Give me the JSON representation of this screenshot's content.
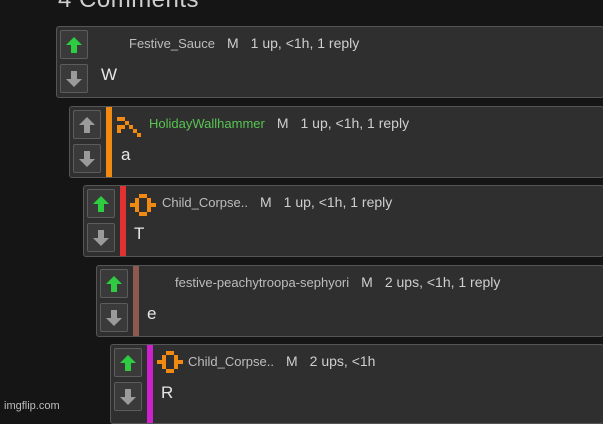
{
  "header": {
    "title": "4 Comments"
  },
  "colors": {
    "upvote": "#2ecc40",
    "downvote": "#9a9a9a",
    "bars": [
      "#f08a13",
      "#e03232",
      "#8c5a4e",
      "#cc22cc"
    ]
  },
  "icons": {
    "upvote": "up-arrow-icon",
    "downvote": "down-arrow-icon",
    "avatar": "pixel-avatar-icon"
  },
  "comments": [
    {
      "user": "Festive_Sauce",
      "flag": "M",
      "stats": "1 up, <1h, 1 reply",
      "text": "W",
      "upvoted": true
    },
    {
      "user": "HolidayWallhammer",
      "flag": "M",
      "stats": "1 up, <1h, 1 reply",
      "text": "a",
      "upvoted": false
    },
    {
      "user": "Child_Corpse..",
      "flag": "M",
      "stats": "1 up, <1h, 1 reply",
      "text": "T",
      "upvoted": true
    },
    {
      "user": "festive-peachytroopa-sephyori",
      "flag": "M",
      "stats": "2 ups, <1h, 1 reply",
      "text": "e",
      "upvoted": true
    },
    {
      "user": "Child_Corpse..",
      "flag": "M",
      "stats": "2 ups, <1h",
      "text": "R",
      "upvoted": true
    }
  ],
  "watermark": "imgflip.com"
}
